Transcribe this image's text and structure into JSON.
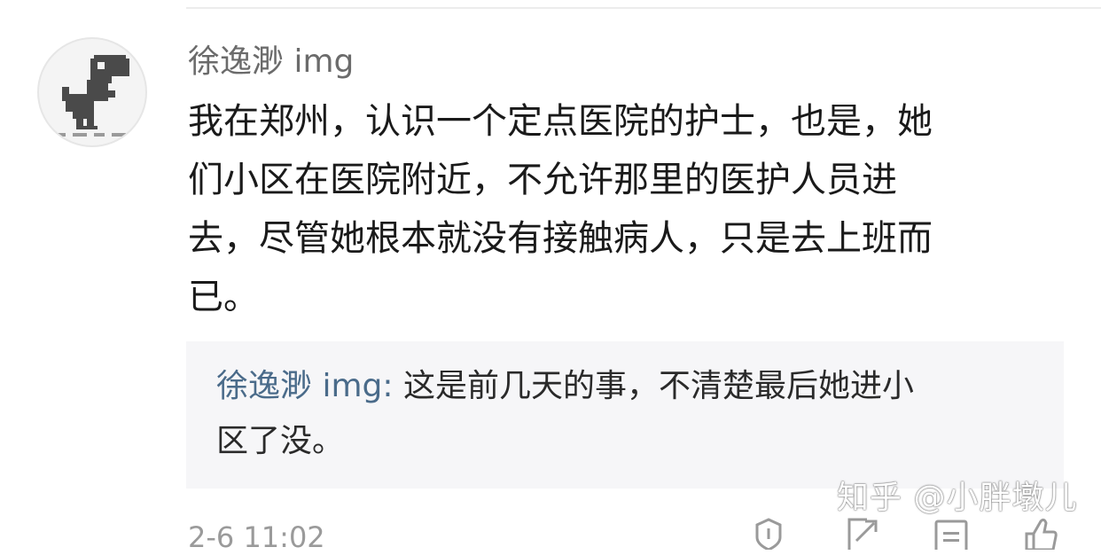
{
  "comment": {
    "author": "徐逸渺 img",
    "lines": [
      "我在郑州，认识一个定点医院的护士，也是，她",
      "们小区在医院附近，不允许那里的医护人员进",
      "去，尽管她根本就没有接触病人，只是去上班而",
      "已。"
    ],
    "timestamp": "2-6 11:02",
    "reply": {
      "author": "徐逸渺 img",
      "separator": ": ",
      "line1": "这是前几天的事，不清楚最后她进小",
      "line2": "区了没。"
    },
    "actions": [
      "report-icon",
      "share-icon",
      "reply-icon",
      "like-icon"
    ]
  },
  "watermark": "知乎 @小胖墩儿",
  "colors": {
    "reply_author": "#4a6b8a",
    "reply_background": "#f6f6f8",
    "meta_text": "#9a9a9a"
  }
}
